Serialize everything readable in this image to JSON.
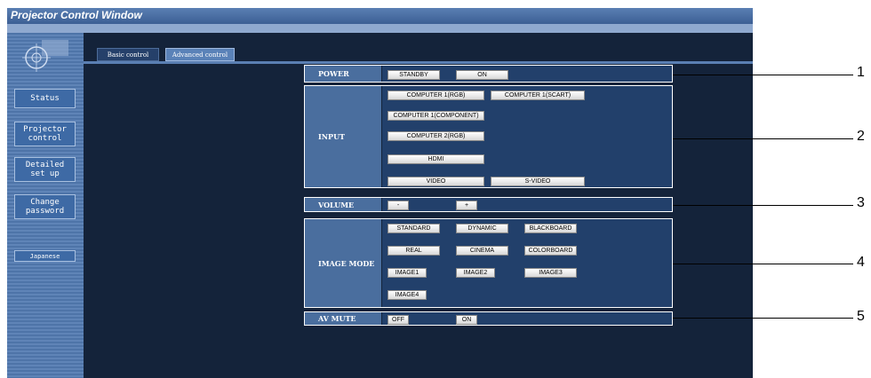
{
  "window": {
    "title": "Projector Control Window"
  },
  "sidebar": {
    "status": "Status",
    "projector_control": "Projector\ncontrol",
    "detailed_setup": "Detailed\nset up",
    "change_password": "Change\npassword",
    "language": "Japanese"
  },
  "tabs": {
    "basic": "Basic control",
    "advanced": "Advanced control"
  },
  "power": {
    "label": "POWER",
    "standby": "STANDBY",
    "on": "ON"
  },
  "input": {
    "label": "INPUT",
    "computer1_rgb": "COMPUTER 1(RGB)",
    "computer1_scart": "COMPUTER 1(SCART)",
    "computer1_component": "COMPUTER 1(COMPONENT)",
    "computer2_rgb": "COMPUTER 2(RGB)",
    "hdmi": "HDMI",
    "video": "VIDEO",
    "svideo": "S-VIDEO"
  },
  "volume": {
    "label": "VOLUME",
    "down": "-",
    "up": "+"
  },
  "image_mode": {
    "label": "IMAGE MODE",
    "standard": "STANDARD",
    "dynamic": "DYNAMIC",
    "blackboard": "BLACKBOARD",
    "real": "REAL",
    "cinema": "CINEMA",
    "colorboard": "COLORBOARD",
    "image1": "IMAGE1",
    "image2": "IMAGE2",
    "image3": "IMAGE3",
    "image4": "IMAGE4"
  },
  "av_mute": {
    "label": "AV MUTE",
    "off": "OFF",
    "on": "ON"
  },
  "callouts": [
    "1",
    "2",
    "3",
    "4",
    "5"
  ]
}
